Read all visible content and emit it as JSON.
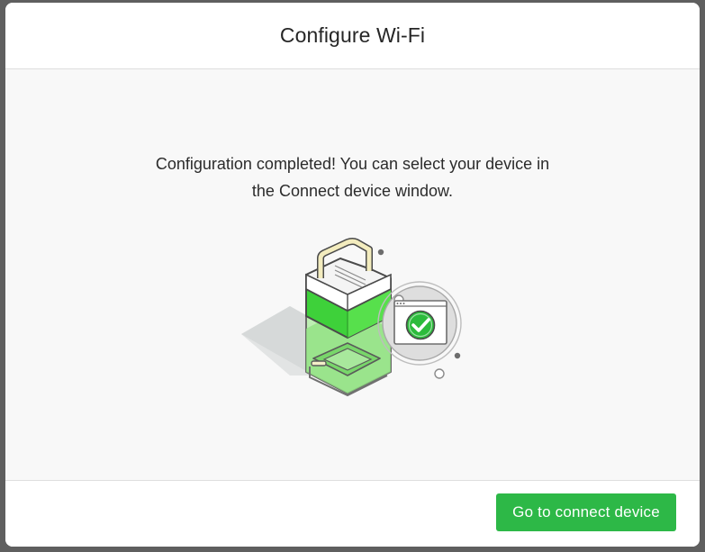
{
  "dialog": {
    "title": "Configure Wi-Fi",
    "message_line_1": "Configuration completed! You can select your device in",
    "message_line_2": "the Connect device window.",
    "primary_button_label": "Go to connect device",
    "illustration": {
      "device": "printer-box-icon",
      "status": "success-checkmark-icon"
    }
  },
  "colors": {
    "accent_green": "#2db847",
    "check_green": "#2cbb3c",
    "header_bg": "#ffffff",
    "body_bg": "#f8f8f8",
    "title_text": "#262626"
  }
}
